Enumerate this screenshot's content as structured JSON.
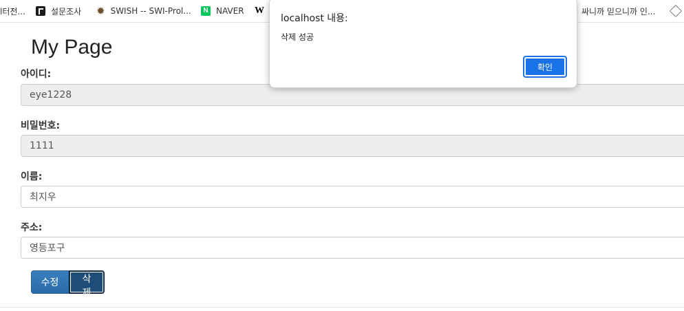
{
  "bookmarks": [
    {
      "label": "l터전...",
      "icon": "none"
    },
    {
      "label": "설문조사",
      "icon": "document-icon"
    },
    {
      "label": "SWISH -- SWI-Prol...",
      "icon": "gear-icon"
    },
    {
      "label": "NAVER",
      "icon": "naver-icon"
    },
    {
      "label": "W",
      "icon": "wikipedia-icon"
    },
    {
      "label": "싸니까 믿으니까 인...",
      "icon": "none"
    },
    {
      "label": "",
      "icon": "cube-icon"
    }
  ],
  "page": {
    "title": "My Page"
  },
  "form": {
    "id_label": "아이디:",
    "id_value": "eye1228",
    "password_label": "비밀번호:",
    "password_value": "1111",
    "name_label": "이름:",
    "name_value": "최지우",
    "address_label": "주소:",
    "address_value": "영등포구",
    "edit_label": "수정",
    "delete_label": "삭제"
  },
  "dialog": {
    "title": "localhost 내용:",
    "message": "삭제 성공",
    "ok_label": "확인",
    "accent": "#1a73e8"
  }
}
